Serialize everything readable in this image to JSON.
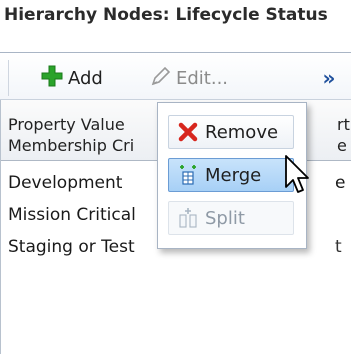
{
  "title": "Hierarchy Nodes: Lifecycle Status",
  "toolbar": {
    "add_label": "Add",
    "edit_label": "Edit...",
    "more_label": "»"
  },
  "table": {
    "headers": [
      "Property Value Membership Cri",
      "rt e"
    ],
    "rows": [
      {
        "name": "Development",
        "value": "e"
      },
      {
        "name": "Mission Critical",
        "value": ""
      },
      {
        "name": "Staging or Test",
        "value": ""
      }
    ]
  },
  "menu": {
    "items": [
      {
        "label": "Remove",
        "state": "normal"
      },
      {
        "label": "Merge",
        "state": "hover"
      },
      {
        "label": "Split",
        "state": "disabled"
      }
    ]
  },
  "colors": {
    "add_green": "#2aa32a",
    "remove_red": "#d7261e",
    "merge_hover": "#a7d0f6",
    "more_blue": "#1e4f9c"
  }
}
